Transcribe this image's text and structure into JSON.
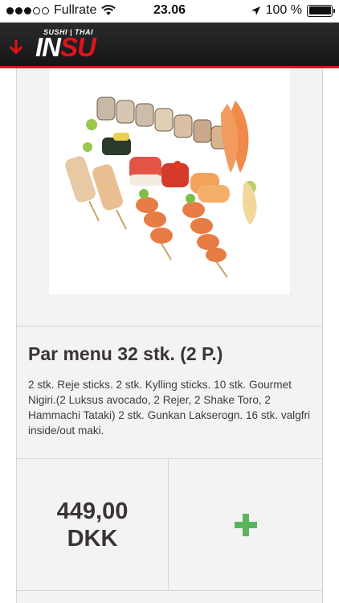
{
  "status_bar": {
    "carrier": "Fullrate",
    "time": "23.06",
    "battery": "100 %",
    "signal_dots_filled": 3,
    "signal_dots_total": 5,
    "icons": [
      "wifi-icon",
      "location-arrow-icon",
      "battery-icon"
    ]
  },
  "app_bar": {
    "logo_tagline": "SUSHI | THAI",
    "logo_in": "IN",
    "logo_su": "SU",
    "back_icon": "arrow-down-icon",
    "accent_color": "#d7161c",
    "background_color": "#1f1f21"
  },
  "product": {
    "title": "Par menu 32 stk. (2 P.)",
    "description": "2 stk. Reje sticks. 2 stk. Kylling sticks. 10 stk. Gourmet Nigiri.(2 Luksus avocado, 2 Rejer, 2 Shake Toro, 2 Hammachi Tataki) 2 stk. Gunkan Lakserogn. 16 stk. valgfri inside/out maki.",
    "price_amount": "449,00",
    "price_currency": "DKK",
    "add_icon": "plus-icon",
    "add_color": "#5ab55e"
  }
}
